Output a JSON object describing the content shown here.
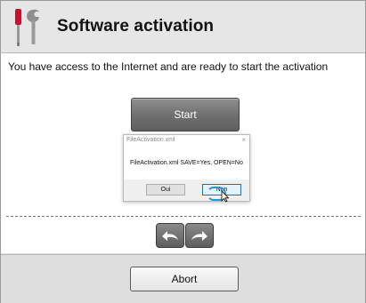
{
  "window": {
    "title": "Software activation",
    "icon": "tools-icon"
  },
  "main": {
    "message": "You have access to the Internet and are ready to start the activation",
    "start_label": "Start"
  },
  "dialog": {
    "title": "FileActivation.xml",
    "close_glyph": "×",
    "text": "FileActivation.xml SAVE=Yes, OPEN=No",
    "buttons": {
      "yes_label": "Oui",
      "no_label": "Non"
    }
  },
  "navigation": {
    "back_icon": "back-arrow-icon",
    "forward_icon": "forward-arrow-icon"
  },
  "footer": {
    "abort_label": "Abort"
  },
  "colors": {
    "accent_focus": "#2a95c9",
    "screwdriver_handle": "#c8102e",
    "button_dark": "#6e6e6e"
  }
}
